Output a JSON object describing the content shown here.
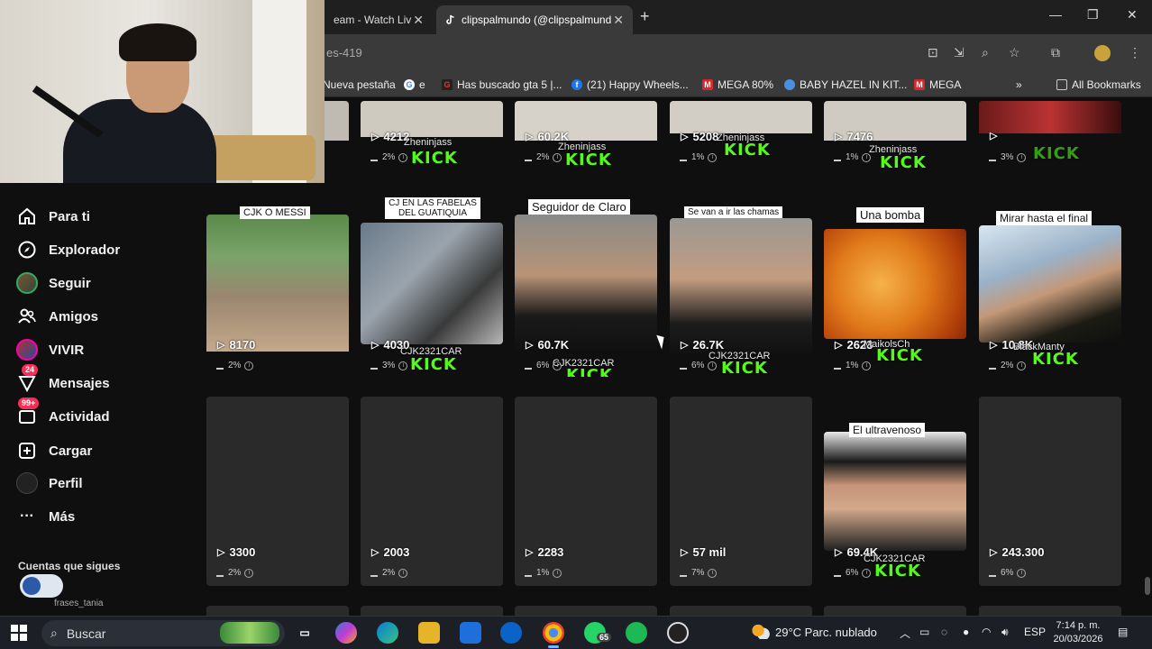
{
  "browser": {
    "tabs": [
      {
        "title": "eam - Watch Liv"
      },
      {
        "title": "clipspalmundo (@clipspalmund"
      }
    ],
    "url_fragment": "es-419",
    "bookmarks": [
      {
        "label": "Nueva pestaña"
      },
      {
        "label": "e"
      },
      {
        "label": "Has buscado gta 5 |..."
      },
      {
        "label": "(21) Happy Wheels..."
      },
      {
        "label": "MEGA 80%"
      },
      {
        "label": "BABY HAZEL IN KIT..."
      },
      {
        "label": "MEGA"
      },
      {
        "label": "All Bookmarks"
      }
    ]
  },
  "sidebar": {
    "items": [
      {
        "label": "Para ti",
        "icon": "home-icon"
      },
      {
        "label": "Explorador",
        "icon": "compass-icon"
      },
      {
        "label": "Seguir",
        "icon": "avatar-icon"
      },
      {
        "label": "Amigos",
        "icon": "friends-icon"
      },
      {
        "label": "VIVIR",
        "icon": "live-icon"
      },
      {
        "label": "Mensajes",
        "icon": "message-icon",
        "badge": "24"
      },
      {
        "label": "Actividad",
        "icon": "inbox-icon",
        "badge": "99+"
      },
      {
        "label": "Cargar",
        "icon": "upload-icon"
      },
      {
        "label": "Perfil",
        "icon": "profile-icon"
      },
      {
        "label": "Más",
        "icon": "more-icon"
      }
    ],
    "following_title": "Cuentas que sigues",
    "following_user": "frases_tania"
  },
  "grid": {
    "row0": [
      {
        "views": "4212",
        "pct": "2%",
        "watermark": "Zheninjass",
        "kick": "KICK"
      },
      {
        "views": "60.2K",
        "pct": "2%",
        "watermark": "Zheninjass",
        "kick": "KICK"
      },
      {
        "views": "5208",
        "pct": "1%",
        "watermark": "Zheninjass",
        "kick": "KICK"
      },
      {
        "views": "7476",
        "pct": "1%",
        "watermark": "Zheninjass",
        "kick": "KICK"
      },
      {
        "views": "",
        "pct": "3%",
        "watermark": "",
        "kick": "KICK"
      }
    ],
    "row1": [
      {
        "caption": "CJK O MESSI",
        "views": "8170",
        "pct": "2%",
        "watermark": "",
        "kick": ""
      },
      {
        "caption": "CJ EN LAS FABELAS DEL GUATIQUIA",
        "views": "4030",
        "pct": "3%",
        "watermark": "CJK2321CAR",
        "kick": "KICK"
      },
      {
        "caption": "Seguidor de Claro",
        "views": "60.7K",
        "pct": "6%",
        "watermark": "CJK2321CAR",
        "kick": "KICK"
      },
      {
        "caption": "Se van a ir las chamas",
        "views": "26.7K",
        "pct": "6%",
        "watermark": "CJK2321CAR",
        "kick": "KICK"
      },
      {
        "caption": "Una bomba",
        "views": "2623",
        "pct": "1%",
        "watermark": "MaikolsCh",
        "kick": "KICK"
      },
      {
        "caption": "Mirar hasta el final",
        "views": "10.8K",
        "pct": "2%",
        "watermark": "BlackManty",
        "kick": "KICK"
      }
    ],
    "row2": [
      {
        "caption": "",
        "views": "3300",
        "pct": "2%"
      },
      {
        "caption": "",
        "views": "2003",
        "pct": "2%"
      },
      {
        "caption": "",
        "views": "2283",
        "pct": "1%"
      },
      {
        "caption": "",
        "views": "57 mil",
        "pct": "7%"
      },
      {
        "caption": "El ultravenoso",
        "views": "69.4K",
        "pct": "6%",
        "watermark": "CJK2321CAR",
        "kick": "KICK"
      },
      {
        "caption": "",
        "views": "243.300",
        "pct": "6%"
      }
    ]
  },
  "taskbar": {
    "search_placeholder": "Buscar",
    "whatsapp_badge": "65",
    "weather": "29°C  Parc. nublado",
    "language": "ESP",
    "time": "7:14 p. m.",
    "date": "20/03/2026"
  }
}
